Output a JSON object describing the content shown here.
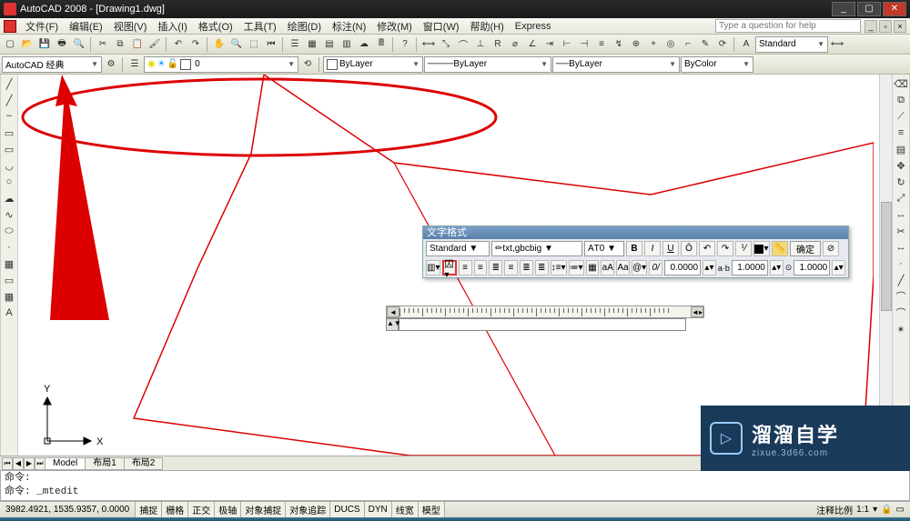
{
  "title": "AutoCAD 2008 - [Drawing1.dwg]",
  "menu": [
    "文件(F)",
    "编辑(E)",
    "视图(V)",
    "插入(I)",
    "格式(O)",
    "工具(T)",
    "绘图(D)",
    "标注(N)",
    "修改(M)",
    "窗口(W)",
    "帮助(H)",
    "Express"
  ],
  "help_search_placeholder": "Type a question for help",
  "toolbar2": {
    "workspace": "AutoCAD 经典",
    "linetype": "ByLayer",
    "lineweight": "ByLayer",
    "color": "ByLayer",
    "plot_style": "ByColor",
    "text_style": "Standard"
  },
  "text_format": {
    "title": "文字格式",
    "style": "Standard",
    "font": "txt,gbcbig",
    "height": "T0",
    "ok": "确定",
    "tracking": "0.0000",
    "width_factor": "1.0000",
    "oblique": "1.0000"
  },
  "tabs": {
    "model": "Model",
    "layout1": "布局1",
    "layout2": "布局2"
  },
  "command": {
    "line1": "命令:",
    "line2": "命令: _mtedit"
  },
  "status": {
    "coords": "3982.4921, 1535.9357, 0.0000",
    "buttons": [
      "捕捉",
      "栅格",
      "正交",
      "极轴",
      "对象捕捉",
      "对象追踪",
      "DUCS",
      "DYN",
      "线宽",
      "模型"
    ],
    "scale_label": "注释比例",
    "scale": "1:1"
  },
  "ucs": {
    "x": "X",
    "y": "Y"
  },
  "icons": {
    "line": "╱",
    "polyline": "~",
    "rect": "▭",
    "arc": "◡",
    "circle": "○",
    "cloud": "☁",
    "spline": "∿",
    "ellipse": "⬭",
    "hatch": "▦",
    "point": "·",
    "text": "A",
    "erase": "⌫",
    "copy": "⧉",
    "mirror": "⟋",
    "offset": "≡",
    "array": "▤",
    "move": "✥",
    "rotate": "↻",
    "scale": "⤢",
    "trim": "✂",
    "extend": "↔",
    "fillet": "⌒",
    "explode": "✴"
  },
  "watermark": {
    "main": "溜溜自学",
    "sub": "zixue.3d66.com"
  }
}
